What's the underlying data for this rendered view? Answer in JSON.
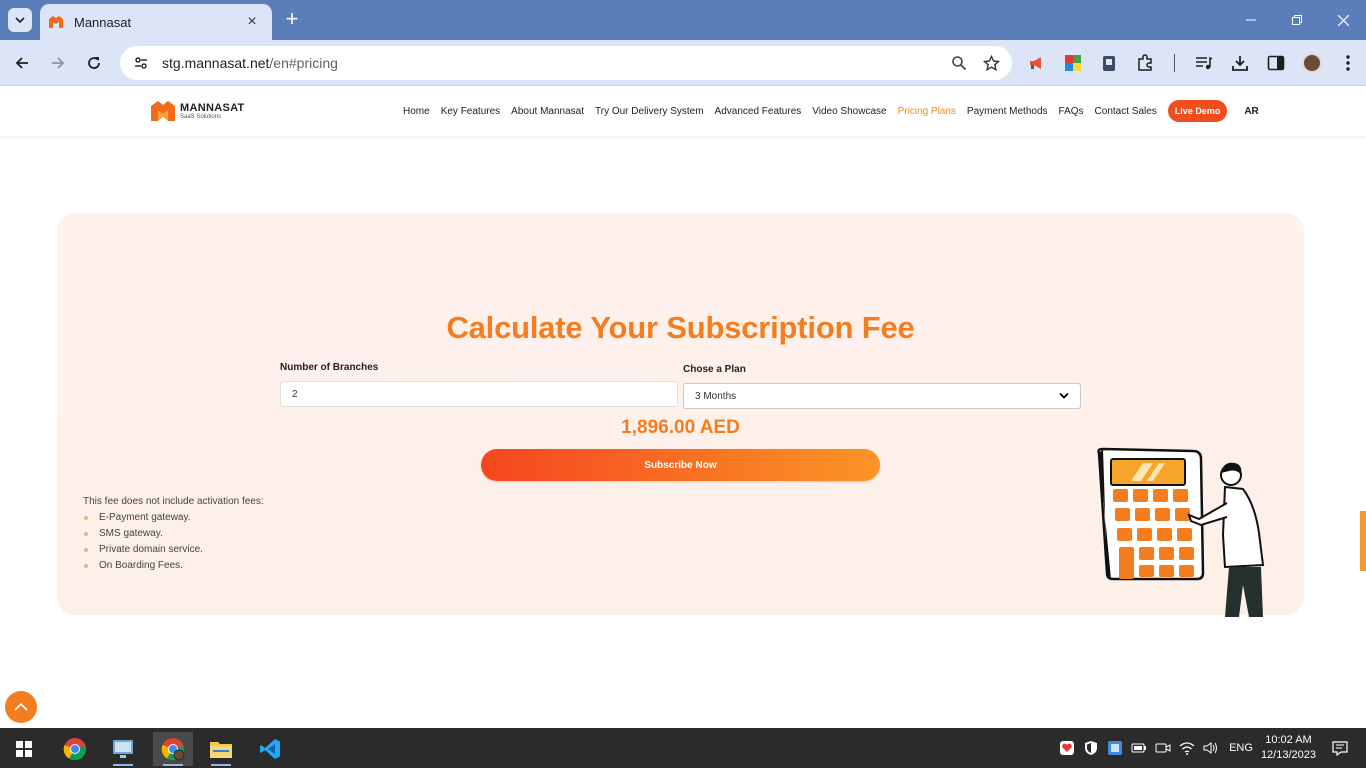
{
  "browser": {
    "tab_title": "Mannasat",
    "url_host": "stg.mannasat.net",
    "url_path": "/en#pricing"
  },
  "site": {
    "logo_name": "MANNASAT",
    "logo_sub": "SaaS Solutions",
    "nav": [
      "Home",
      "Key Features",
      "About Mannasat",
      "Try Our Delivery System",
      "Advanced Features",
      "Video Showcase",
      "Pricing Plans",
      "Payment Methods",
      "FAQs",
      "Contact Sales"
    ],
    "active_nav": "Pricing Plans",
    "live_demo_label": "Live Demo",
    "lang_toggle": "AR"
  },
  "calculator": {
    "title": "Calculate Your Subscription Fee",
    "branches_label": "Number of Branches",
    "branches_value": "2",
    "plan_label": "Chose a Plan",
    "plan_value": "3 Months",
    "total": "1,896.00 AED",
    "subscribe_label": "Subscribe Now",
    "note_title": "This fee does not include activation fees:",
    "excluded": [
      "E-Payment gateway.",
      "SMS gateway.",
      "Private domain service.",
      "On Boarding Fees."
    ]
  },
  "taskbar": {
    "lang": "ENG",
    "time": "10:02 AM",
    "date": "12/13/2023"
  },
  "icons": {
    "back_to_top": "arrow-up-icon",
    "illustration": "calculator-person-illustration"
  },
  "colors": {
    "accent": "#f47e1f",
    "cta_start": "#f5461f",
    "cta_end": "#fb9526",
    "card_bg": "#fff1ee"
  }
}
